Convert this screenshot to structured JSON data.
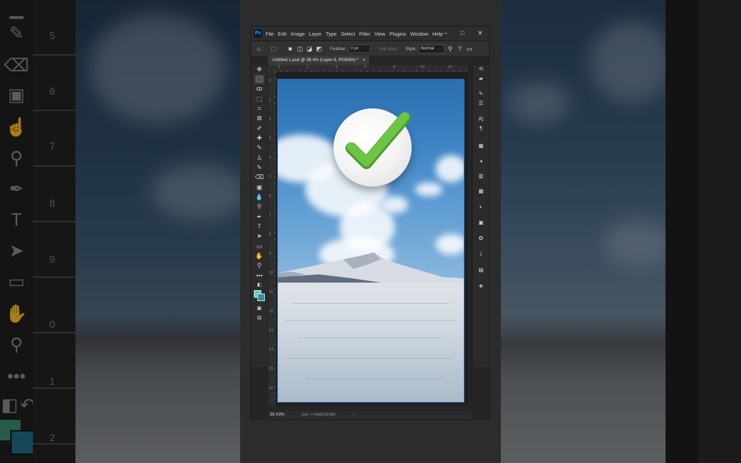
{
  "window": {
    "menu": [
      "File",
      "Edit",
      "Image",
      "Layer",
      "Type",
      "Select",
      "Filter",
      "View",
      "Plugins",
      "Window",
      "Help"
    ],
    "app_logo": "Ps",
    "minimize": "–",
    "maximize": "□",
    "close": "✕"
  },
  "options_bar": {
    "feather_label": "Feather:",
    "feather_value": "0 px",
    "anti_alias_label": "Anti-alias",
    "style_label": "Style:",
    "style_value": "Normal"
  },
  "document": {
    "tab_title": "Untitled-1.psd @ 39.4% (Layer 8, RGB/8#) *",
    "tab_close": "×"
  },
  "rulers": {
    "horizontal": [
      "0",
      "2",
      "4",
      "6",
      "8",
      "10",
      "12"
    ],
    "vertical": [
      "0",
      "1",
      "2",
      "3",
      "4",
      "5",
      "6",
      "7",
      "8",
      "9",
      "10",
      "11",
      "12",
      "13",
      "14",
      "15",
      "16"
    ]
  },
  "status": {
    "zoom": "39.43%",
    "doc_info": "Doc: 7.44M/125.8M",
    "arrow": "›"
  },
  "background_ruler": [
    "5",
    "6",
    "7",
    "8",
    "9",
    "0",
    "1",
    "2"
  ],
  "colors": {
    "foreground": "#5fd3b8",
    "background": "#2d8fb0",
    "checkmark": "#6cc644"
  }
}
